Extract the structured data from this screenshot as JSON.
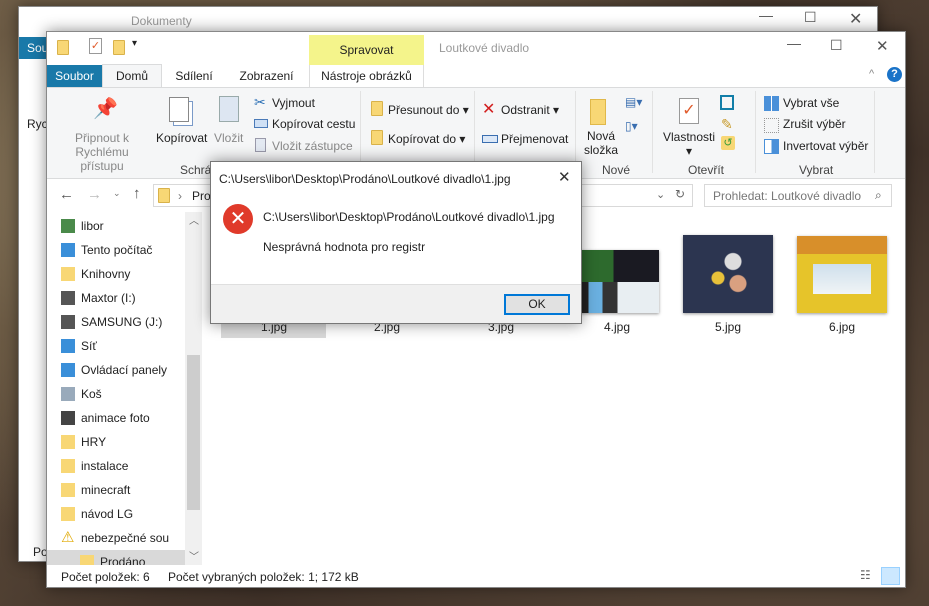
{
  "back_window": {
    "title": "Dokumenty",
    "tab_file": "Sou",
    "ribbon_text": "Ryc",
    "status_text": "Po"
  },
  "window": {
    "title": "Loutkové divadlo",
    "context_tab_header": "Spravovat",
    "tabs": [
      "Soubor",
      "Domů",
      "Sdílení",
      "Zobrazení",
      "Nástroje obrázků"
    ],
    "ribbon": {
      "pin": "Připnout k Rychlému přístupu",
      "copy": "Kopírovat",
      "paste": "Vložit",
      "cut": "Vyjmout",
      "copy_path": "Kopírovat cestu",
      "paste_shortcut": "Vložit zástupce",
      "group_clipboard": "Schránka",
      "move_to": "Přesunout do",
      "copy_to": "Kopírovat do",
      "delete": "Odstranit",
      "rename": "Přejmenovat",
      "new_folder_1": "Nová",
      "new_folder_2": "složka",
      "group_new": "Nové",
      "properties": "Vlastnosti",
      "group_open": "Otevřít",
      "select_all": "Vybrat vše",
      "select_none": "Zrušit výběr",
      "invert": "Invertovat výběr",
      "group_select": "Vybrat"
    },
    "address": "Prodáno",
    "search_placeholder": "Prohledat: Loutkové divadlo",
    "nav_items": [
      "libor",
      "Tento počítač",
      "Knihovny",
      "Maxtor (I:)",
      "SAMSUNG (J:)",
      "Síť",
      "Ovládací panely",
      "Koš",
      "animace foto",
      "HRY",
      "instalace",
      "minecraft",
      "návod LG",
      "nebezpečné sou",
      "Prodáno"
    ],
    "files": [
      "1.jpg",
      "2.jpg",
      "3.jpg",
      "4.jpg",
      "5.jpg",
      "6.jpg"
    ],
    "status": {
      "count": "Počet položek: 6",
      "selected": "Počet vybraných položek: 1; 172 kB"
    }
  },
  "dialog": {
    "title": "C:\\Users\\libor\\Desktop\\Prodáno\\Loutkové divadlo\\1.jpg",
    "path": "C:\\Users\\libor\\Desktop\\Prodáno\\Loutkové divadlo\\1.jpg",
    "message": "Nesprávná hodnota pro registr",
    "ok": "OK"
  },
  "colors": {
    "file_tab": "#1979a9",
    "context": "#f4f48b",
    "error": "#e81123",
    "ok_border": "#0078d7"
  }
}
